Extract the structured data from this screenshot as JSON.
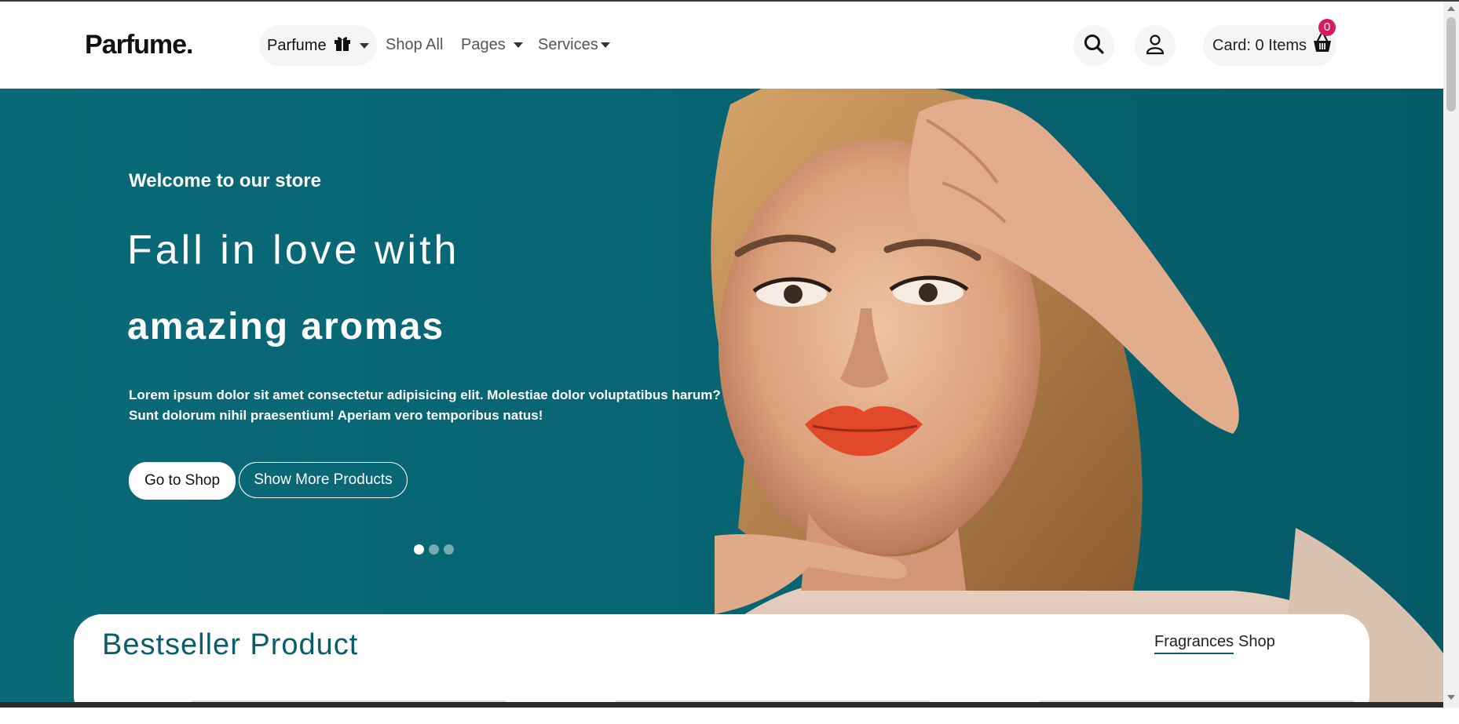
{
  "brand": {
    "logo_text": "Parfume."
  },
  "nav": {
    "dropdown_label": "Parfume",
    "links": [
      {
        "label": "Shop All",
        "has_caret": false
      },
      {
        "label": "Pages",
        "has_caret": true
      },
      {
        "label": "Services",
        "has_caret": true
      }
    ],
    "cart_label": "Card: 0 Items",
    "cart_count": "0"
  },
  "hero": {
    "eyebrow": "Welcome to our store",
    "headline_line1": "Fall in love with",
    "headline_line2": "amazing aromas",
    "description": "Lorem ipsum dolor sit amet consectetur adipisicing elit. Molestiae dolor voluptatibus harum? Sunt dolorum nihil praesentium! Aperiam vero temporibus natus!",
    "primary_button": "Go to Shop",
    "secondary_button": "Show More Products",
    "slides_total": 3,
    "active_slide": 1
  },
  "bestseller": {
    "title": "Bestseller Product",
    "tabs": [
      {
        "label": "Fragrances",
        "active": true
      },
      {
        "label": "Shop",
        "active": false
      }
    ]
  },
  "colors": {
    "brand_teal": "#0b5d6a",
    "hero_bg": "#076573",
    "badge": "#d81b60"
  }
}
